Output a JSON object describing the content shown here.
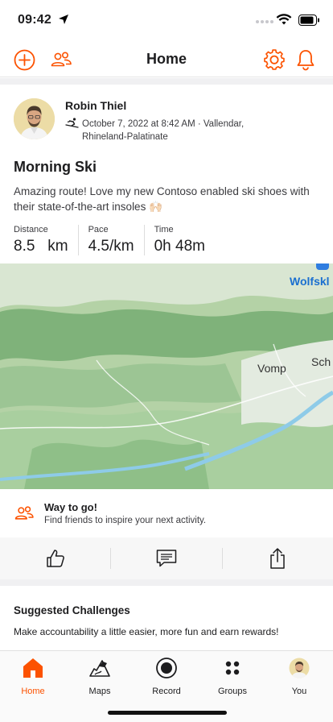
{
  "status_bar": {
    "time": "09:42"
  },
  "nav": {
    "title": "Home"
  },
  "activity": {
    "athlete_name": "Robin Thiel",
    "meta": "October 7, 2022 at 8:42 AM · Vallendar, Rhineland-Palatinate",
    "title": "Morning Ski",
    "description": "Amazing route! Love my new Contoso enabled ski shoes with their state-of-the-art insoles 🙌🏻",
    "stats": [
      {
        "label": "Distance",
        "value": "8.5   km"
      },
      {
        "label": "Pace",
        "value": "4.5/km"
      },
      {
        "label": "Time",
        "value": "0h 48m"
      }
    ]
  },
  "map": {
    "labels": [
      "Wolfskl",
      "Vomp",
      "Sch"
    ]
  },
  "way_to_go": {
    "title": "Way to go!",
    "subtitle": "Find friends to inspire your next activity."
  },
  "actions": {
    "icons": [
      "thumbs-up-icon",
      "comment-icon",
      "share-icon"
    ]
  },
  "challenges": {
    "title": "Suggested Challenges",
    "subtitle": "Make accountability a little easier, more fun and earn rewards!"
  },
  "tabs": [
    {
      "label": "Home",
      "icon": "home-icon",
      "active": true
    },
    {
      "label": "Maps",
      "icon": "map-icon",
      "active": false
    },
    {
      "label": "Record",
      "icon": "record-icon",
      "active": false
    },
    {
      "label": "Groups",
      "icon": "groups-icon",
      "active": false
    },
    {
      "label": "You",
      "icon": "avatar",
      "active": false
    }
  ],
  "colors": {
    "accent": "#fc5200",
    "map_green": "#b8d4ab",
    "river": "#8ecbe8"
  }
}
